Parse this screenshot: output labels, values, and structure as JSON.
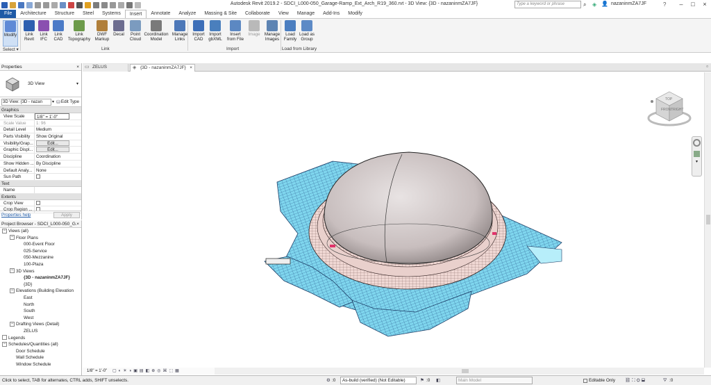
{
  "app": {
    "title": "Autodesk Revit 2019.2 - SDCI_L000-050_Garage-Ramp_Ext_Arch_R19_360.rvt - 3D View: {3D - nazaninmZA7JF}",
    "search_placeholder": "Type a keyword or phrase",
    "user": "nazaninmZA7JF"
  },
  "tabs": [
    "File",
    "Architecture",
    "Structure",
    "Steel",
    "Systems",
    "Insert",
    "Annotate",
    "Analyze",
    "Massing & Site",
    "Collaborate",
    "View",
    "Manage",
    "Add-Ins",
    "Modify"
  ],
  "ribbon": {
    "buttons": [
      {
        "id": "modify",
        "label": "Modify",
        "color": "#5f8ad6"
      },
      {
        "id": "link-revit",
        "label": "Link\nRevit",
        "color": "#2e5fb0"
      },
      {
        "id": "link-ifc",
        "label": "Link\nIFC",
        "color": "#8a4fb0"
      },
      {
        "id": "link-cad",
        "label": "Link\nCAD",
        "color": "#4b7bc7"
      },
      {
        "id": "link-topography",
        "label": "Link\nTopography",
        "color": "#6c9a4a"
      },
      {
        "id": "dwf-markup",
        "label": "DWF\nMarkup",
        "color": "#b07f3a"
      },
      {
        "id": "decal",
        "label": "Decal",
        "color": "#6d6d8f"
      },
      {
        "id": "point-cloud",
        "label": "Point\nCloud",
        "color": "#7b9bbf"
      },
      {
        "id": "coordination-model",
        "label": "Coordination\nModel",
        "color": "#7a7a7a"
      },
      {
        "id": "manage-links",
        "label": "Manage\nLinks",
        "color": "#4d78b8"
      },
      {
        "id": "import-cad",
        "label": "Import\nCAD",
        "color": "#3e6fb8"
      },
      {
        "id": "import-gbxml",
        "label": "Import\ngbXML",
        "color": "#4a7fbd"
      },
      {
        "id": "insert-from-file",
        "label": "Insert\nfrom File",
        "color": "#5c88c2"
      },
      {
        "id": "image",
        "label": "Image",
        "color": "#b9b9b9"
      },
      {
        "id": "manage-images",
        "label": "Manage\nImages",
        "color": "#5d84b3"
      },
      {
        "id": "load-family",
        "label": "Load\nFamily",
        "color": "#4b7ec0"
      },
      {
        "id": "load-as-group",
        "label": "Load as\nGroup",
        "color": "#5d8ac6"
      }
    ],
    "groups": [
      "Select ▾",
      "Link",
      "Import",
      "Load from Library"
    ]
  },
  "properties": {
    "header": "Properties",
    "type_name": "3D View",
    "selector": "3D View: {3D - nazan",
    "edit_type": "Edit Type",
    "groups": {
      "graphics": "Graphics",
      "text": "Text",
      "extents": "Extents"
    },
    "rows": [
      {
        "k": "View Scale",
        "v": "1/8\" = 1'-0\""
      },
      {
        "k": "Scale Value",
        "v": "1:  96"
      },
      {
        "k": "Detail Level",
        "v": "Medium"
      },
      {
        "k": "Parts Visibility",
        "v": "Show Original"
      },
      {
        "k": "Visibility/Grap...",
        "v": "Edit..."
      },
      {
        "k": "Graphic Displ...",
        "v": "Edit..."
      },
      {
        "k": "Discipline",
        "v": "Coordination"
      },
      {
        "k": "Show Hidden ...",
        "v": "By Discipline"
      },
      {
        "k": "Default Analy...",
        "v": "None"
      },
      {
        "k": "Sun Path",
        "v": ""
      }
    ],
    "text_rows": [
      {
        "k": "Name",
        "v": ""
      }
    ],
    "extent_rows": [
      {
        "k": "Crop View",
        "v": ""
      },
      {
        "k": "Crop Region ...",
        "v": ""
      }
    ],
    "help": "Properties help",
    "apply": "Apply"
  },
  "browser": {
    "header": "Project Browser - SDCI_L000-050_G...",
    "items": [
      {
        "t": "Views (all)",
        "lvl": 0,
        "exp": "−"
      },
      {
        "t": "Floor Plans",
        "lvl": 1,
        "exp": "−"
      },
      {
        "t": "000-Event Floor",
        "lvl": 2
      },
      {
        "t": "025-Service",
        "lvl": 2
      },
      {
        "t": "050-Mezzanine",
        "lvl": 2
      },
      {
        "t": "100-Plaza",
        "lvl": 2
      },
      {
        "t": "3D Views",
        "lvl": 1,
        "exp": "−"
      },
      {
        "t": "{3D - nazaninmZA7JF}",
        "lvl": 2,
        "bold": true
      },
      {
        "t": "{3D}",
        "lvl": 2
      },
      {
        "t": "Elevations (Building Elevation",
        "lvl": 1,
        "exp": "−"
      },
      {
        "t": "East",
        "lvl": 2
      },
      {
        "t": "North",
        "lvl": 2
      },
      {
        "t": "South",
        "lvl": 2
      },
      {
        "t": "West",
        "lvl": 2
      },
      {
        "t": "Drafting Views (Detail)",
        "lvl": 1,
        "exp": "−"
      },
      {
        "t": "ZELUS",
        "lvl": 2
      },
      {
        "t": "Legends",
        "lvl": 0,
        "exp": ""
      },
      {
        "t": "Schedules/Quantities (all)",
        "lvl": 0,
        "exp": "−"
      },
      {
        "t": "Door Schedule",
        "lvl": 1
      },
      {
        "t": "Wall Schedule",
        "lvl": 1
      },
      {
        "t": "Window Schedule",
        "lvl": 1
      }
    ]
  },
  "view_tabs": [
    {
      "label": "ZELUS"
    },
    {
      "label": "{3D - nazaninmZA7JF}"
    }
  ],
  "view_control": {
    "scale": "1/8\" = 1'-0\""
  },
  "status": {
    "hint": "Click to select, TAB for alternates, CTRL adds, SHIFT unselects.",
    "zero1": ":0",
    "workset": "As-build (verified) (Not Editable)",
    "zero2": ":0",
    "model": "Main Model",
    "editable_only": "Editable Only",
    "zero3": ":0"
  },
  "viewcube": {
    "front": "FRONT",
    "right": "RIGHT",
    "top": "TOP"
  }
}
